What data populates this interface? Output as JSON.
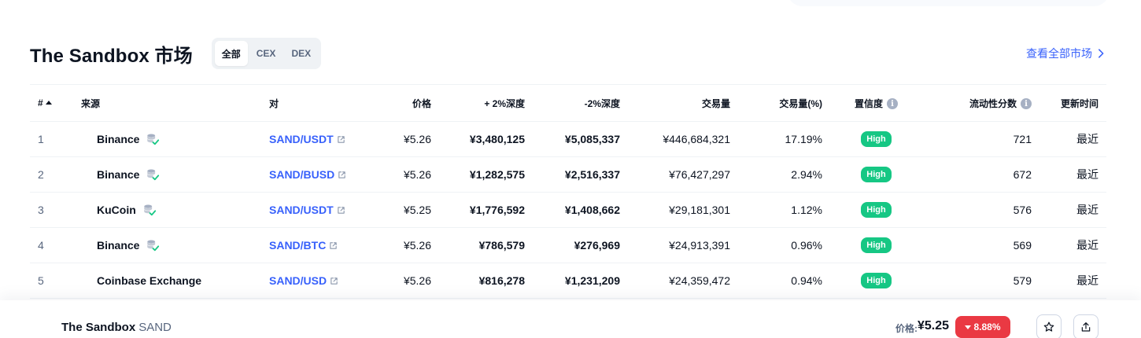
{
  "header": {
    "title": "The Sandbox 市场",
    "filters": [
      {
        "label": "全部",
        "active": true
      },
      {
        "label": "CEX",
        "active": false
      },
      {
        "label": "DEX",
        "active": false
      }
    ],
    "view_all": "查看全部市场"
  },
  "table": {
    "columns": {
      "rank": "#",
      "source": "来源",
      "pair": "对",
      "price": "价格",
      "depth_plus": "+ 2%深度",
      "depth_minus": "-2%深度",
      "volume": "交易量",
      "volume_pct": "交易量(%)",
      "confidence": "置信度",
      "liquidity": "流动性分数",
      "updated": "更新时间"
    },
    "rows": [
      {
        "rank": "1",
        "source": "Binance",
        "verified": true,
        "pair": "SAND/USDT",
        "price": "¥5.26",
        "depth_plus": "¥3,480,125",
        "depth_minus": "¥5,085,337",
        "volume": "¥446,684,321",
        "volume_pct": "17.19%",
        "confidence": "High",
        "liquidity": "721",
        "updated": "最近"
      },
      {
        "rank": "2",
        "source": "Binance",
        "verified": true,
        "pair": "SAND/BUSD",
        "price": "¥5.26",
        "depth_plus": "¥1,282,575",
        "depth_minus": "¥2,516,337",
        "volume": "¥76,427,297",
        "volume_pct": "2.94%",
        "confidence": "High",
        "liquidity": "672",
        "updated": "最近"
      },
      {
        "rank": "3",
        "source": "KuCoin",
        "verified": true,
        "pair": "SAND/USDT",
        "price": "¥5.25",
        "depth_plus": "¥1,776,592",
        "depth_minus": "¥1,408,662",
        "volume": "¥29,181,301",
        "volume_pct": "1.12%",
        "confidence": "High",
        "liquidity": "576",
        "updated": "最近"
      },
      {
        "rank": "4",
        "source": "Binance",
        "verified": true,
        "pair": "SAND/BTC",
        "price": "¥5.26",
        "depth_plus": "¥786,579",
        "depth_minus": "¥276,969",
        "volume": "¥24,913,391",
        "volume_pct": "0.96%",
        "confidence": "High",
        "liquidity": "569",
        "updated": "最近"
      },
      {
        "rank": "5",
        "source": "Coinbase Exchange",
        "verified": false,
        "pair": "SAND/USD",
        "price": "¥5.26",
        "depth_plus": "¥816,278",
        "depth_minus": "¥1,231,209",
        "volume": "¥24,359,472",
        "volume_pct": "0.94%",
        "confidence": "High",
        "liquidity": "579",
        "updated": "最近"
      }
    ]
  },
  "bottom_bar": {
    "name": "The Sandbox",
    "symbol": "SAND",
    "price_label": "价格:",
    "price": "¥5.25",
    "change": "8.88%",
    "icons": [
      "star-icon",
      "share-icon"
    ]
  },
  "colors": {
    "accent": "#3861fb",
    "high_badge": "#16c784",
    "negative": "#ea3943",
    "text": "#0d1421",
    "muted": "#58667e"
  }
}
